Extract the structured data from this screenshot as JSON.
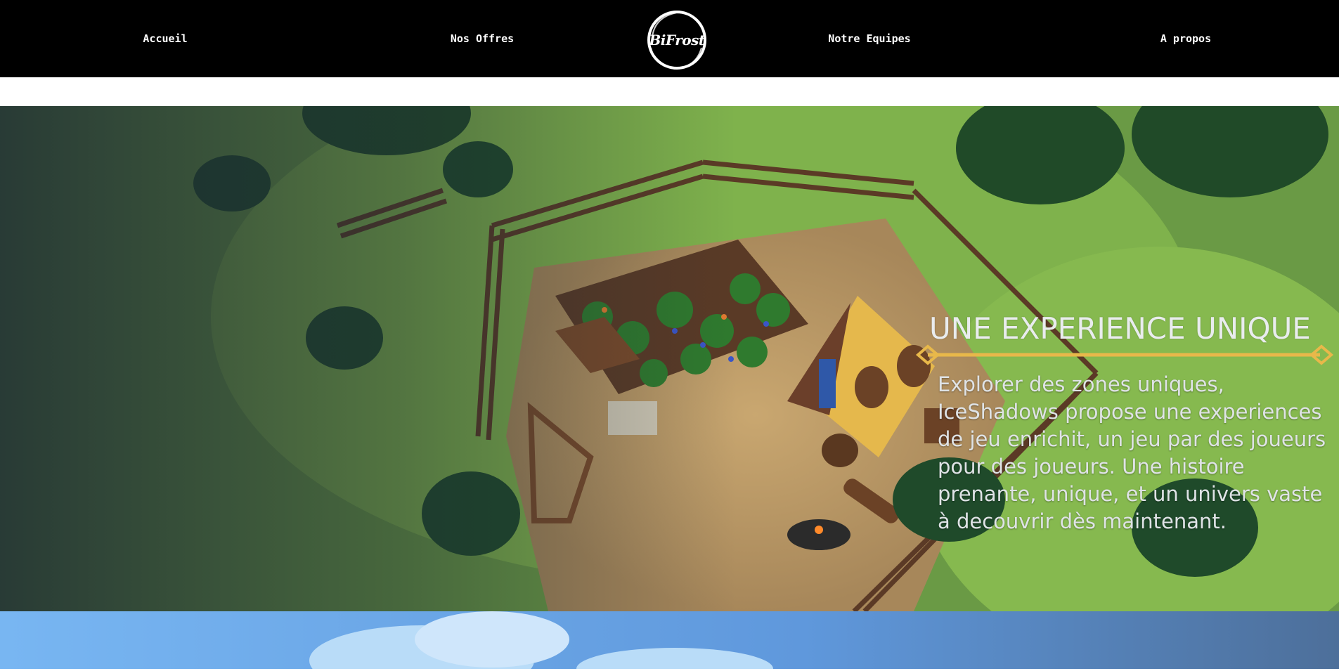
{
  "nav": {
    "links": [
      "Accueil",
      "Nos Offres",
      "Notre Equipes",
      "A propos"
    ],
    "logo_text": "BiFrost"
  },
  "hero": {
    "title": "UNE EXPERIENCE UNIQUE",
    "text": "Explorer des zones uniques, IceShadows propose une experiences de jeu enrichit, un jeu par des joueurs pour des joueurs. Une histoire prenante, unique, et un univers vaste à decouvrir dès maintenant.",
    "accent_color": "#e8b84a",
    "image": "game-scene-farm-camp"
  },
  "colors": {
    "navbar_bg": "#000000",
    "nav_text": "#ffffff",
    "page_bg": "#ffffff",
    "sky": "#7ab8f0"
  }
}
